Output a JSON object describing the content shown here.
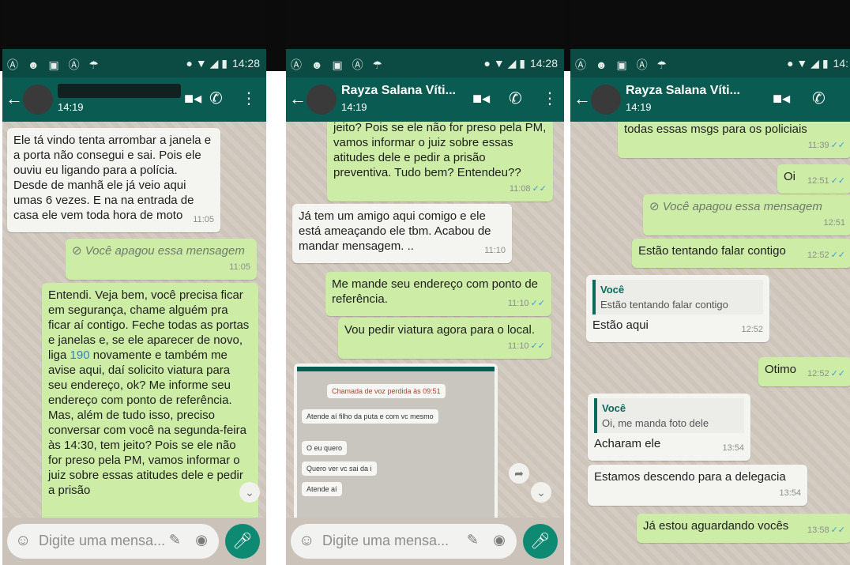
{
  "statusbar": {
    "left_icons": "Ⓐ ☻ ▣ Ⓐ ☂",
    "right_icons": "● ▼ ◢ ▮",
    "times": [
      "14:28",
      "14:28",
      "14:"
    ]
  },
  "panels": [
    {
      "contact": "",
      "last_seen": "14:19",
      "messages": [
        {
          "type": "in",
          "text": "Ele tá vindo tenta arrombar a janela e a porta não consegui e sai. Pois ele ouviu eu ligando para a polícia. Desde de manhã ele já veio aqui umas 6 vezes. E na na entrada de casa ele vem toda hora de moto",
          "time": "11:05"
        },
        {
          "type": "out-deleted",
          "text": "⊘ Você apagou essa mensagem",
          "time": "11:05"
        },
        {
          "type": "out",
          "text_before": "Entendi. Veja bem, você precisa ficar em segurança, chame alguém pra ficar aí contigo. Feche todas as portas e janelas e, se ele aparecer de novo, liga ",
          "link": "190",
          "text_after": " novamente e também me avise aqui, daí solicito viatura para seu endereço, ok? Me informe seu endereço com ponto de referência. Mas, além de tudo isso, preciso conversar com você na segunda-feira às 14:30, tem jeito? Pois se ele não for preso pela PM, vamos informar o juiz sobre essas atitudes dele e pedir a prisão"
        }
      ],
      "input_placeholder": "Digite uma mensa..."
    },
    {
      "contact": "Rayza Salana Víti...",
      "last_seen": "14:19",
      "messages": [
        {
          "type": "out",
          "text": "jeito? Pois se ele não for preso pela PM, vamos informar o juiz sobre essas atitudes dele e pedir a prisão preventiva. Tudo bem? Entendeu??",
          "time": "11:08"
        },
        {
          "type": "in",
          "text": "Já tem um amigo aqui comigo e ele está ameaçando ele tbm. Acabou de mandar mensagem. ..",
          "time": "11:10"
        },
        {
          "type": "out",
          "text": "Me mande seu endereço com ponto de referência.",
          "time": "11:10"
        },
        {
          "type": "out",
          "text": "Vou pedir viatura agora para o local.",
          "time": "11:10"
        }
      ],
      "screenshot": {
        "missed_call": "Chamada de voz perdida às 09:51",
        "lines": [
          "Atende aí filho da puta e com vc mesmo",
          "O eu quero",
          "Quero ver vc sai da i",
          "Atende aí"
        ]
      },
      "input_placeholder": "Digite uma mensa..."
    },
    {
      "contact": "Rayza Salana Víti...",
      "last_seen": "14:19",
      "messages": [
        {
          "type": "out",
          "text": "todas essas msgs para os policiais",
          "time": "11:39"
        },
        {
          "type": "out",
          "text": "Oi",
          "time": "12:51"
        },
        {
          "type": "out-deleted",
          "text": "⊘ Você apagou essa mensagem",
          "time": "12:51"
        },
        {
          "type": "out",
          "text": "Estão tentando falar contigo",
          "time": "12:52"
        },
        {
          "type": "in-quote",
          "quote_author": "Você",
          "quote_text": "Estão tentando falar contigo",
          "text": "Estão aqui",
          "time": "12:52"
        },
        {
          "type": "out",
          "text": "Otimo",
          "time": "12:52"
        },
        {
          "type": "in-quote",
          "quote_author": "Você",
          "quote_text": "Oi, me manda foto dele",
          "text": "Acharam ele",
          "time": "13:54"
        },
        {
          "type": "in",
          "text": "Estamos descendo para a delegacia",
          "time": "13:54"
        },
        {
          "type": "out",
          "text": "Já estou aguardando vocês",
          "time": "13:58"
        }
      ]
    }
  ]
}
